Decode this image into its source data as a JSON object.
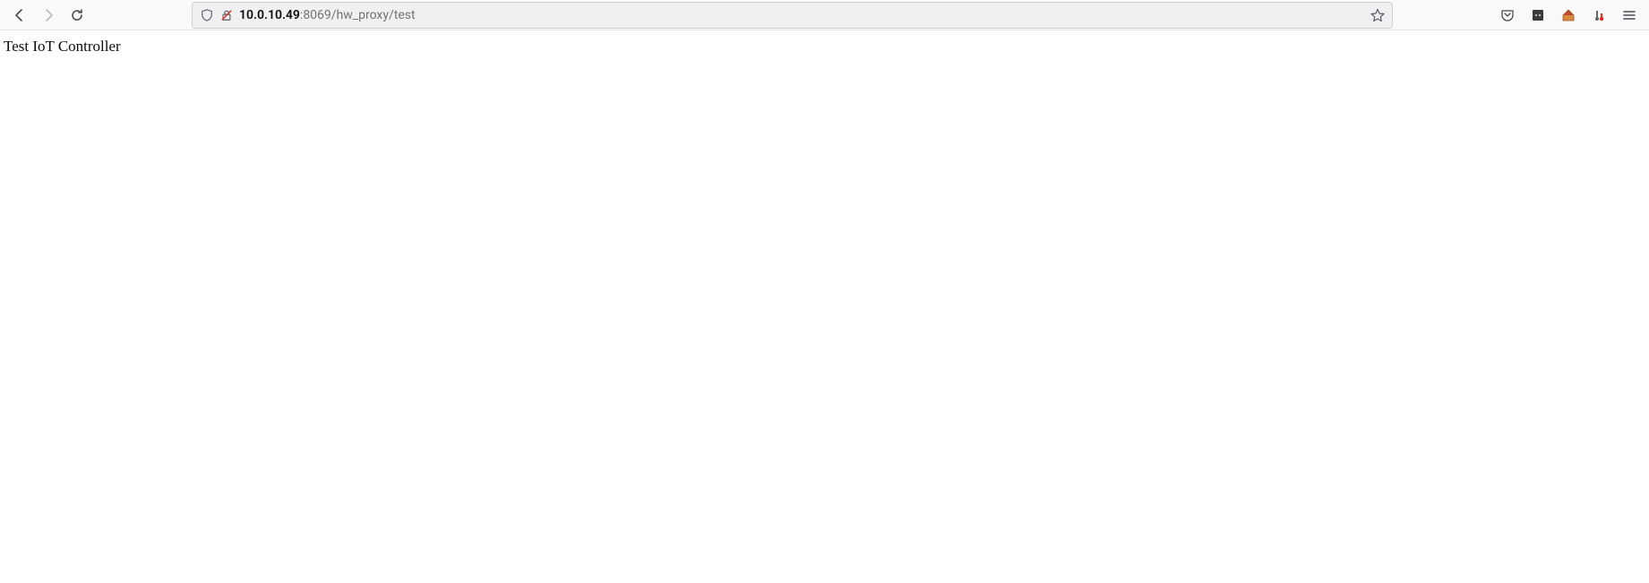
{
  "address": {
    "host": "10.0.10.49",
    "rest": ":8069/hw_proxy/test"
  },
  "page": {
    "title": "Test IoT Controller"
  }
}
